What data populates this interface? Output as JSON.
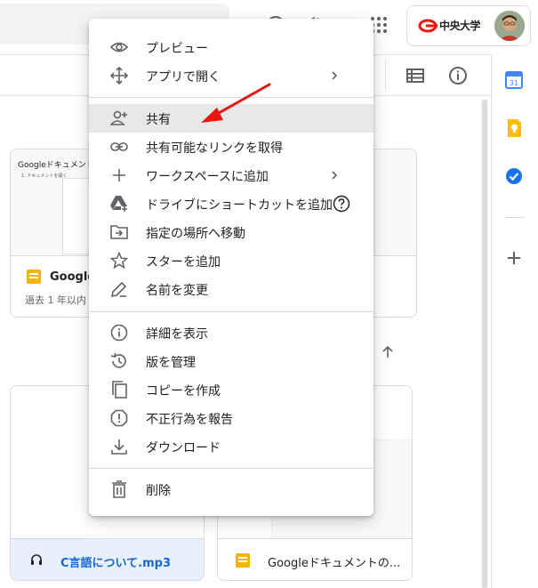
{
  "account": {
    "logo_text": "中央大学"
  },
  "cards": [
    {
      "thumb_title": "Googleドキュメントで共",
      "thumb_subtitle": "1. ドキュメントを開く",
      "name": "Google",
      "meta": "過去 1 年以内"
    },
    {
      "name": "C言語について.mp3"
    },
    {
      "name": "Googleドキュメントの..."
    }
  ],
  "context_menu": {
    "items": [
      {
        "label": "プレビュー",
        "icon": "eye-icon"
      },
      {
        "label": "アプリで開く",
        "icon": "move-arrows-icon",
        "has_submenu": true
      },
      {
        "label": "共有",
        "icon": "person-add-icon",
        "highlighted": true
      },
      {
        "label": "共有可能なリンクを取得",
        "icon": "link-icon"
      },
      {
        "label": "ワークスペースに追加",
        "icon": "plus-icon",
        "has_submenu": true
      },
      {
        "label": "ドライブにショートカットを追加",
        "icon": "drive-shortcut-icon",
        "has_help": true
      },
      {
        "label": "指定の場所へ移動",
        "icon": "move-to-folder-icon"
      },
      {
        "label": "スターを追加",
        "icon": "star-icon"
      },
      {
        "label": "名前を変更",
        "icon": "pencil-icon"
      },
      {
        "label": "詳細を表示",
        "icon": "info-icon"
      },
      {
        "label": "版を管理",
        "icon": "history-icon"
      },
      {
        "label": "コピーを作成",
        "icon": "copy-icon"
      },
      {
        "label": "不正行為を報告",
        "icon": "report-icon"
      },
      {
        "label": "ダウンロード",
        "icon": "download-icon"
      },
      {
        "label": "削除",
        "icon": "trash-icon"
      }
    ]
  },
  "colors": {
    "accent_red": "#e8160c",
    "hover_gray": "#e8e8e8",
    "doc_yellow": "#f4b400",
    "selected_blue": "#e8f0fe"
  }
}
